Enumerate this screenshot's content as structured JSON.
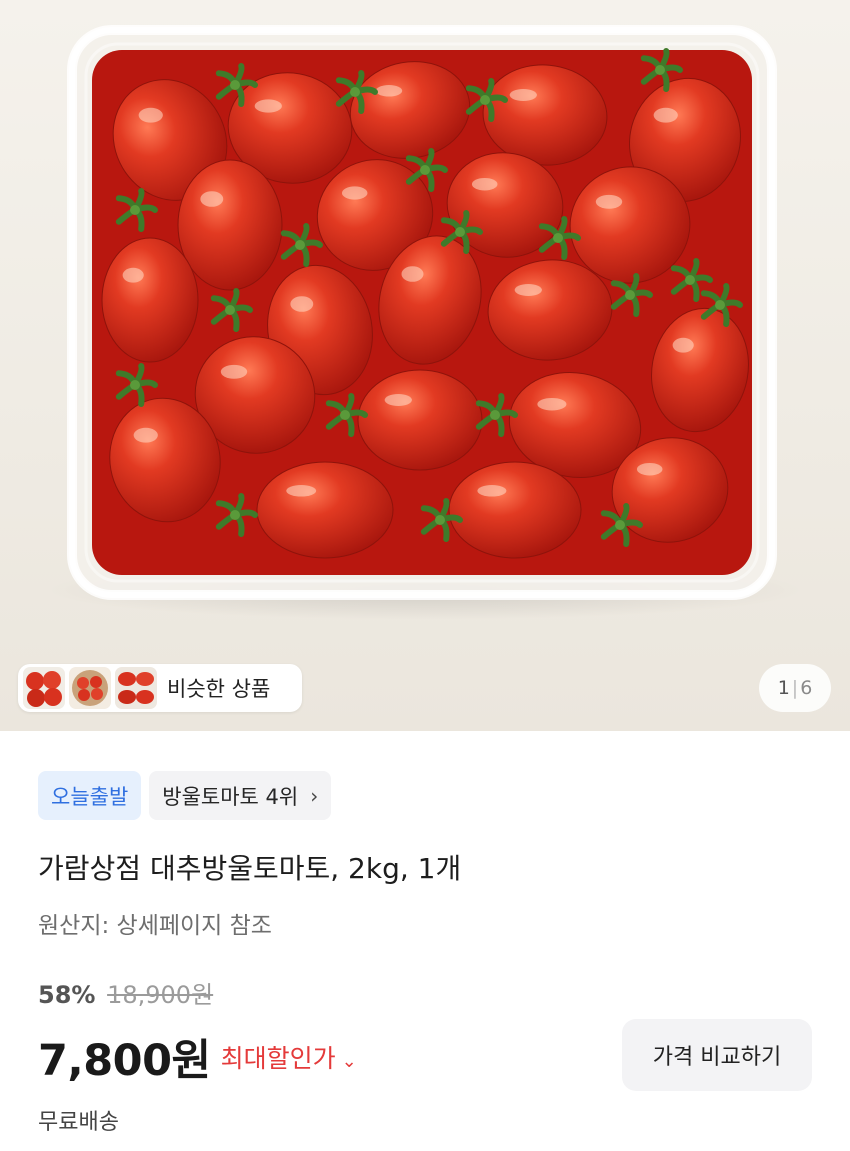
{
  "gallery": {
    "similar_label": "비슷한 상품",
    "counter_current": "1",
    "counter_separator": "|",
    "counter_total": "6"
  },
  "tags": {
    "today_ship": "오늘출발",
    "rank": "방울토마토 4위",
    "rank_chevron": "›"
  },
  "product": {
    "title": "가람상점 대추방울토마토, 2kg, 1개",
    "origin": "원산지: 상세페이지 참조"
  },
  "pricing": {
    "discount": "58%",
    "original_price": "18,900원",
    "price": "7,800원",
    "best_price_label": "최대할인가",
    "best_price_chevron": "⌄",
    "compare_button": "가격 비교하기",
    "shipping": "무료배송"
  },
  "colors": {
    "accent_blue": "#2f6fe0",
    "sale_red": "#e43a3a",
    "tomato": "#d8321f"
  },
  "icons": [
    "chevron-right-icon",
    "chevron-down-icon"
  ]
}
